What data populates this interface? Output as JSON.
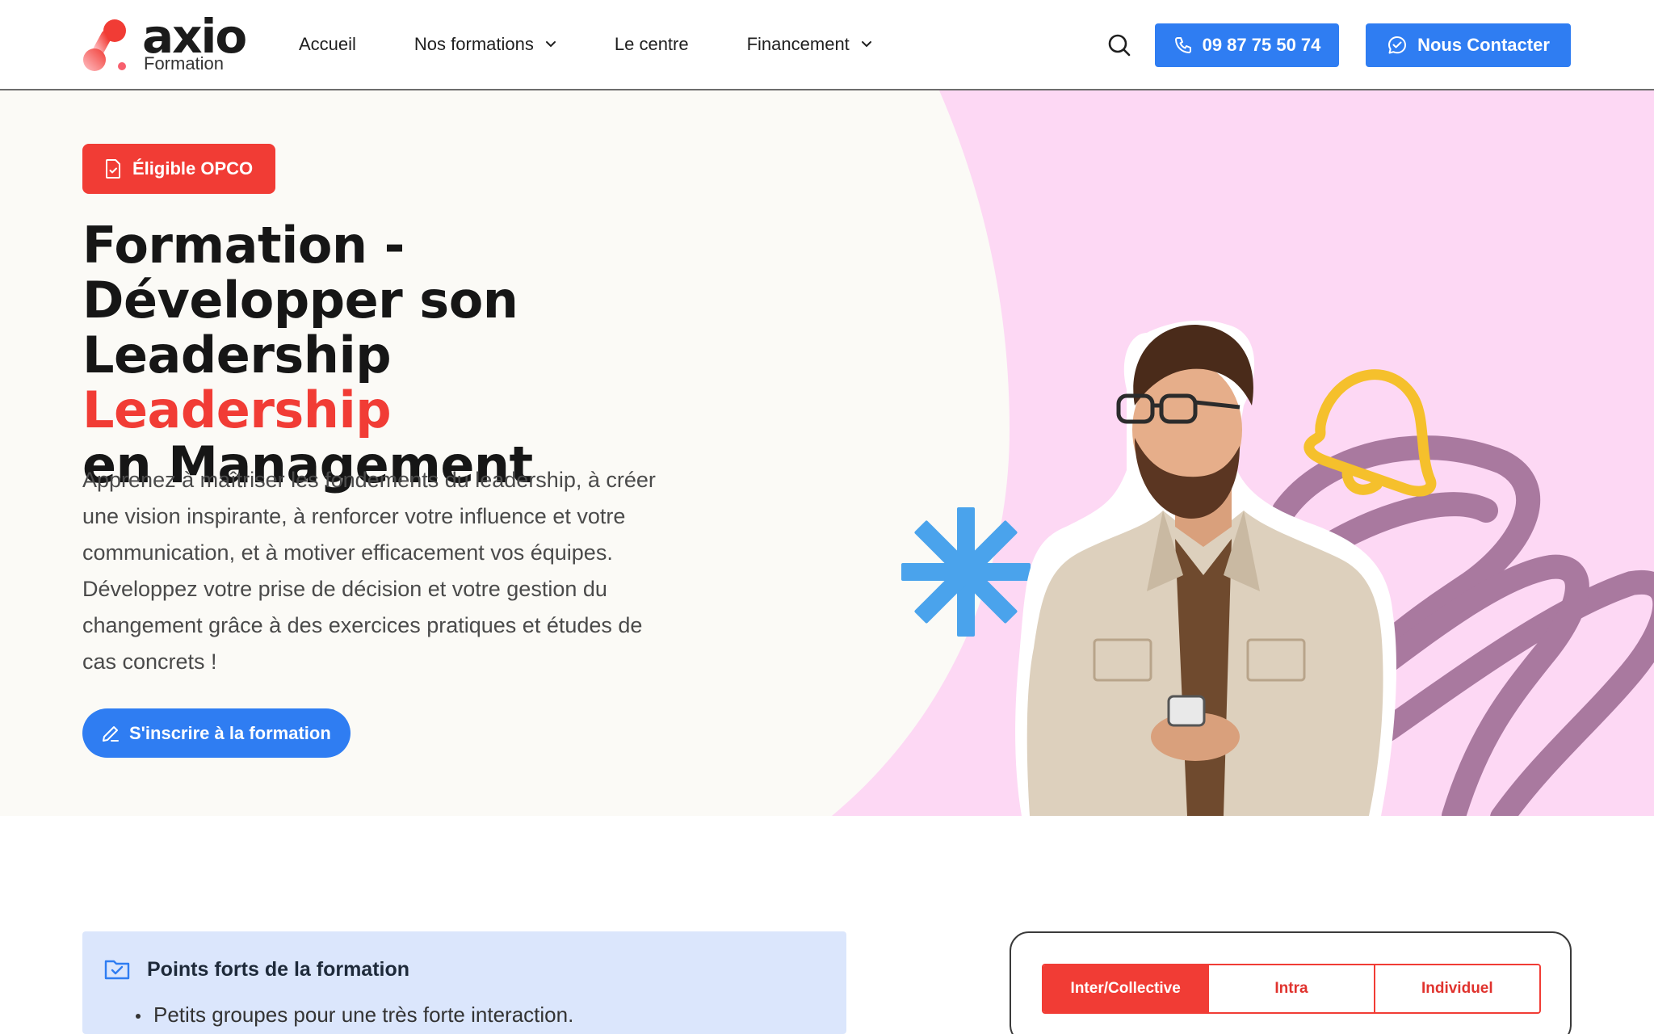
{
  "brand": {
    "name": "axio",
    "subtitle": "Formation",
    "colors": {
      "red": "#f13c35",
      "blue": "#2f7df2",
      "pink": "#fdd8f4",
      "purple": "#a9799f",
      "yellow": "#f5c02c",
      "cyan": "#4aa3ec"
    }
  },
  "nav": {
    "items": [
      {
        "label": "Accueil",
        "has_dropdown": false
      },
      {
        "label": "Nos formations",
        "has_dropdown": true
      },
      {
        "label": "Le centre",
        "has_dropdown": false
      },
      {
        "label": "Financement",
        "has_dropdown": true
      }
    ],
    "search_icon": "search-icon",
    "phone_label": "09 87 75 50 74",
    "contact_label": "Nous Contacter"
  },
  "hero": {
    "badge_label": "Éligible OPCO",
    "title_line1": "Formation -",
    "title_line2": "Développer son",
    "title_line3_dark": "Leadership",
    "title_line3_accent": "Leadership",
    "title_line4": "en Management",
    "description": "Apprenez à maîtriser les fondements du leadership, à créer une vision inspirante, à renforcer votre influence et votre communication, et à motiver efficacement vos équipes. Développez votre prise de décision et votre gestion du changement grâce à des exercices pratiques et études de cas concrets !",
    "cta_label": "S'inscrire à la formation"
  },
  "highlights": {
    "title": "Points forts de la formation",
    "items": [
      "Petits groupes pour une très forte interaction."
    ]
  },
  "pricing": {
    "tabs": [
      {
        "label": "Inter/Collective",
        "active": true
      },
      {
        "label": "Intra",
        "active": false
      },
      {
        "label": "Individuel",
        "active": false
      }
    ]
  }
}
